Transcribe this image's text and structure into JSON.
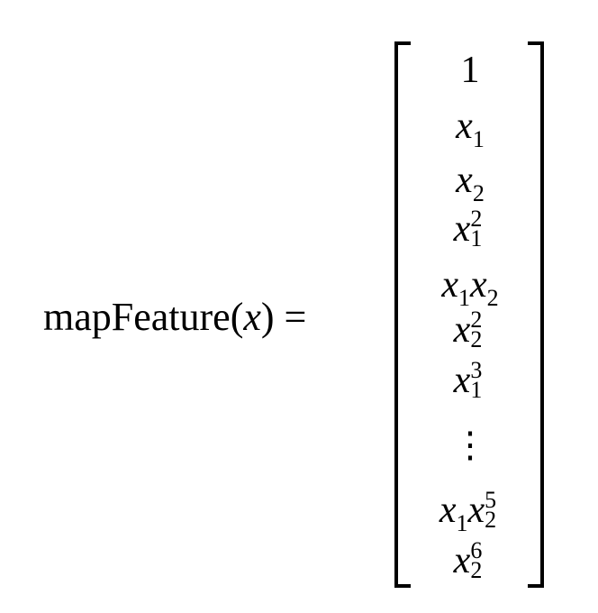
{
  "equation": {
    "lhs": {
      "function_name": "mapFeature",
      "open_paren": "(",
      "variable": "x",
      "close_paren": ")",
      "equals": "="
    },
    "rows": [
      {
        "base": "1",
        "base_italic": false
      },
      {
        "base": "x",
        "sub": "1"
      },
      {
        "base": "x",
        "sub": "2"
      },
      {
        "base": "x",
        "sub": "1",
        "sup": "2"
      },
      {
        "terms": [
          {
            "base": "x",
            "sub": "1"
          },
          {
            "base": "x",
            "sub": "2"
          }
        ]
      },
      {
        "base": "x",
        "sub": "2",
        "sup": "2"
      },
      {
        "base": "x",
        "sub": "1",
        "sup": "3"
      },
      {
        "dots": "⋮"
      },
      {
        "terms": [
          {
            "base": "x",
            "sub": "1"
          },
          {
            "base": "x",
            "sub": "2",
            "sup": "5"
          }
        ]
      },
      {
        "base": "x",
        "sub": "2",
        "sup": "6"
      }
    ]
  }
}
